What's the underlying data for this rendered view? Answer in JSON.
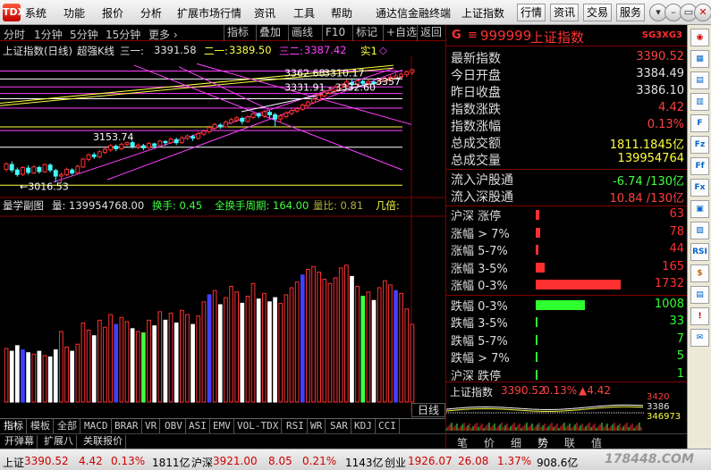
{
  "menubar": {
    "logo": "TDX",
    "items": [
      "系统",
      "功能",
      "报价",
      "分析",
      "扩展市场行情",
      "资讯",
      "工具",
      "帮助"
    ],
    "center_title": "通达信金融终端",
    "index_name": "上证指数",
    "buttons": [
      "行情",
      "资讯",
      "交易",
      "服务"
    ],
    "window_controls": [
      "▾",
      "–",
      "▭",
      "✕"
    ]
  },
  "periodbar": {
    "periods": [
      "分时",
      "1分钟",
      "5分钟",
      "15分钟",
      "更多 ›"
    ],
    "tools": [
      "指标",
      "叠加",
      "画线",
      "F10",
      "标记",
      "+自选",
      "返回"
    ]
  },
  "chart_header": {
    "title": "上证指数(日线)",
    "indicator": "超强K线",
    "line1_label": "三一:",
    "line1_value": "3391.58",
    "line2_label": "二一:",
    "line2_value": "3389.50",
    "line3_label": "三二:",
    "line3_value": "3387.42",
    "tag": "实1",
    "tag_icon": "◇"
  },
  "chart_labels": {
    "high_label": "3362.68",
    "mid_label": "3310.17",
    "range_label": "3331.91 - 3332.60",
    "right_label": "3357",
    "peak_left": "3153.74",
    "low_label": "←3016.53"
  },
  "volume_header": {
    "title": "量学副图",
    "vol_label": "量: 139954768.00",
    "turnover_label": "换手: 0.45",
    "full_turnover_label": "全换手周期: 164.00",
    "ratio_label": "量比: 0.81",
    "extra_label": "几倍:"
  },
  "daily_label": "日线",
  "indicator_tabs": [
    "指标",
    "模板",
    "全部",
    "MACD",
    "BRAR",
    "VR",
    "OBV",
    "ASI",
    "EMV",
    "VOL-TDX",
    "RSI",
    "WR",
    "SAR",
    "KDJ",
    "CCI"
  ],
  "bottom_tabs": [
    "开弹幕",
    "扩展八",
    "关联报价"
  ],
  "quote": {
    "g_label": "G",
    "menu_icon": "≡",
    "code": "999999",
    "name": "上证指数",
    "badge": "SG3XG3",
    "rows": [
      {
        "label": "最新指数",
        "value": "3390.52",
        "color": "#ff4040"
      },
      {
        "label": "今日开盘",
        "value": "3384.49",
        "color": "#e0e0e0"
      },
      {
        "label": "昨日收盘",
        "value": "3386.10",
        "color": "#e0e0e0"
      },
      {
        "label": "指数涨跌",
        "value": "4.42",
        "color": "#ff4040"
      },
      {
        "label": "指数涨幅",
        "value": "0.13%",
        "color": "#ff4040"
      },
      {
        "label": "总成交额",
        "value": "1811.1845亿",
        "color": "#ffff40"
      },
      {
        "label": "总成交量",
        "value": "139954764",
        "color": "#ffff40"
      }
    ],
    "flow_rows": [
      {
        "label": "流入沪股通",
        "value": "-6.74 /130亿",
        "color": "#40ff40"
      },
      {
        "label": "流入深股通",
        "value": "10.84 /130亿",
        "color": "#ff4040"
      }
    ]
  },
  "breadth": {
    "up_rows": [
      {
        "label": "沪深 涨停",
        "value": "63",
        "color": "#ff3030",
        "fill": 0.04
      },
      {
        "label": "涨幅 > 7%",
        "value": "78",
        "color": "#ff3030",
        "fill": 0.05
      },
      {
        "label": "涨幅 5-7%",
        "value": "44",
        "color": "#ff3030",
        "fill": 0.03
      },
      {
        "label": "涨幅 3-5%",
        "value": "165",
        "color": "#ff3030",
        "fill": 0.1
      },
      {
        "label": "涨幅 0-3%",
        "value": "1732",
        "color": "#ff3030",
        "fill": 1.0
      }
    ],
    "down_rows": [
      {
        "label": "跌幅 0-3%",
        "value": "1008",
        "color": "#30ff30",
        "fill": 0.58
      },
      {
        "label": "跌幅 3-5%",
        "value": "33",
        "color": "#30ff30",
        "fill": 0.02
      },
      {
        "label": "跌幅 5-7%",
        "value": "7",
        "color": "#30ff30",
        "fill": 0.006
      },
      {
        "label": "跌幅 > 7%",
        "value": "5",
        "color": "#30ff30",
        "fill": 0.004
      },
      {
        "label": "沪深 跌停",
        "value": "1",
        "color": "#30ff30",
        "fill": 0.002
      }
    ]
  },
  "mini_chart": {
    "name": "上证指数",
    "price": "3390.52",
    "change_pct": "0.13%",
    "change": "▲4.42",
    "axis_high": "3420",
    "axis_mid": "3386",
    "axis_vol": "346973"
  },
  "right_tabs": [
    "笔",
    "价",
    "细",
    "势",
    "联",
    "值"
  ],
  "right_icons": [
    "◉",
    "▦",
    "▤",
    "▥",
    "F",
    "Fz",
    "Ff",
    "Fx",
    "▣",
    "▧",
    "RSI",
    "$",
    "▤",
    "!",
    "✉"
  ],
  "statusbar": {
    "sh_label": "上证",
    "sh_value": "3390.52",
    "sh_change": "4.42",
    "sh_pct": "0.13%",
    "sh_amount": "1811亿",
    "hs_label": "沪深",
    "hs_value": "3921.00",
    "hs_change": "8.05",
    "hs_pct": "0.21%",
    "hs_amount": "1143亿",
    "cy_label": "创业",
    "cy_value": "1926.07",
    "cy_change": "26.08",
    "cy_pct": "1.37%",
    "cy_amount": "908.6亿",
    "watermark": "178448.COM"
  },
  "chart_data": {
    "type": "candlestick",
    "title": "上证指数(日线)",
    "ylim": [
      2990,
      3420
    ],
    "candles": [
      [
        3062,
        3080,
        3055,
        3085
      ],
      [
        3078,
        3060,
        3052,
        3088
      ],
      [
        3060,
        3045,
        3038,
        3068
      ],
      [
        3046,
        3068,
        3040,
        3072
      ],
      [
        3066,
        3052,
        3045,
        3075
      ],
      [
        3050,
        3070,
        3046,
        3076
      ],
      [
        3068,
        3055,
        3048,
        3074
      ],
      [
        3054,
        3078,
        3050,
        3082
      ],
      [
        3076,
        3060,
        3052,
        3082
      ],
      [
        3058,
        3040,
        3020,
        3064
      ],
      [
        3040,
        3045,
        3016,
        3052
      ],
      [
        3044,
        3062,
        3040,
        3068
      ],
      [
        3060,
        3050,
        3044,
        3066
      ],
      [
        3050,
        3072,
        3046,
        3078
      ],
      [
        3070,
        3096,
        3066,
        3100
      ],
      [
        3095,
        3110,
        3088,
        3115
      ],
      [
        3110,
        3104,
        3096,
        3118
      ],
      [
        3103,
        3120,
        3098,
        3126
      ],
      [
        3118,
        3128,
        3112,
        3134
      ],
      [
        3126,
        3140,
        3120,
        3145
      ],
      [
        3138,
        3130,
        3122,
        3144
      ],
      [
        3130,
        3145,
        3124,
        3150
      ],
      [
        3144,
        3150,
        3138,
        3154
      ],
      [
        3150,
        3138,
        3130,
        3156
      ],
      [
        3136,
        3142,
        3128,
        3148
      ],
      [
        3140,
        3133,
        3125,
        3146
      ],
      [
        3134,
        3148,
        3128,
        3152
      ],
      [
        3146,
        3140,
        3132,
        3150
      ],
      [
        3140,
        3155,
        3135,
        3160
      ],
      [
        3154,
        3150,
        3140,
        3158
      ],
      [
        3150,
        3162,
        3145,
        3168
      ],
      [
        3160,
        3150,
        3142,
        3166
      ],
      [
        3150,
        3166,
        3146,
        3172
      ],
      [
        3165,
        3172,
        3158,
        3178
      ],
      [
        3170,
        3165,
        3156,
        3176
      ],
      [
        3164,
        3180,
        3160,
        3186
      ],
      [
        3178,
        3188,
        3172,
        3194
      ],
      [
        3186,
        3200,
        3180,
        3206
      ],
      [
        3198,
        3210,
        3192,
        3216
      ],
      [
        3208,
        3203,
        3195,
        3214
      ],
      [
        3202,
        3218,
        3198,
        3224
      ],
      [
        3216,
        3226,
        3210,
        3232
      ],
      [
        3225,
        3232,
        3218,
        3238
      ],
      [
        3230,
        3220,
        3210,
        3236
      ],
      [
        3220,
        3235,
        3215,
        3240
      ],
      [
        3233,
        3245,
        3228,
        3250
      ],
      [
        3244,
        3238,
        3230,
        3250
      ],
      [
        3238,
        3252,
        3232,
        3258
      ],
      [
        3250,
        3242,
        3232,
        3256
      ],
      [
        3242,
        3228,
        3204,
        3248
      ],
      [
        3228,
        3238,
        3215,
        3244
      ],
      [
        3236,
        3248,
        3230,
        3254
      ],
      [
        3246,
        3256,
        3240,
        3262
      ],
      [
        3254,
        3262,
        3248,
        3268
      ],
      [
        3260,
        3274,
        3255,
        3280
      ],
      [
        3272,
        3284,
        3266,
        3290
      ],
      [
        3282,
        3294,
        3276,
        3300
      ],
      [
        3292,
        3306,
        3286,
        3312
      ],
      [
        3304,
        3316,
        3298,
        3322
      ],
      [
        3314,
        3322,
        3308,
        3330
      ],
      [
        3320,
        3332,
        3315,
        3340
      ],
      [
        3330,
        3340,
        3324,
        3346
      ],
      [
        3338,
        3350,
        3332,
        3358
      ],
      [
        3348,
        3342,
        3334,
        3362
      ],
      [
        3342,
        3354,
        3336,
        3360
      ],
      [
        3352,
        3346,
        3338,
        3358
      ],
      [
        3346,
        3352,
        3338,
        3360
      ],
      [
        3350,
        3344,
        3336,
        3356
      ],
      [
        3344,
        3356,
        3340,
        3362
      ],
      [
        3354,
        3360,
        3346,
        3366
      ],
      [
        3358,
        3366,
        3350,
        3372
      ],
      [
        3364,
        3370,
        3356,
        3378
      ],
      [
        3368,
        3376,
        3360,
        3382
      ],
      [
        3374,
        3384,
        3366,
        3388
      ],
      [
        3382,
        3390,
        3374,
        3394
      ]
    ],
    "volumes": [
      0.38,
      0.36,
      0.4,
      0.37,
      0.35,
      0.34,
      0.36,
      0.33,
      0.32,
      0.37,
      0.5,
      0.39,
      0.36,
      0.41,
      0.56,
      0.51,
      0.47,
      0.58,
      0.53,
      0.62,
      0.55,
      0.6,
      0.57,
      0.52,
      0.5,
      0.49,
      0.58,
      0.54,
      0.64,
      0.58,
      0.63,
      0.56,
      0.65,
      0.62,
      0.55,
      0.61,
      0.71,
      0.76,
      0.79,
      0.69,
      0.74,
      0.82,
      0.78,
      0.7,
      0.75,
      0.84,
      0.73,
      0.77,
      0.71,
      0.74,
      0.7,
      0.76,
      0.81,
      0.85,
      0.9,
      0.94,
      0.96,
      0.92,
      0.87,
      0.84,
      0.88,
      0.95,
      0.97,
      0.89,
      0.82,
      0.75,
      0.78,
      0.72,
      0.81,
      0.86,
      0.83,
      0.79,
      0.77,
      0.66,
      0.55
    ]
  }
}
